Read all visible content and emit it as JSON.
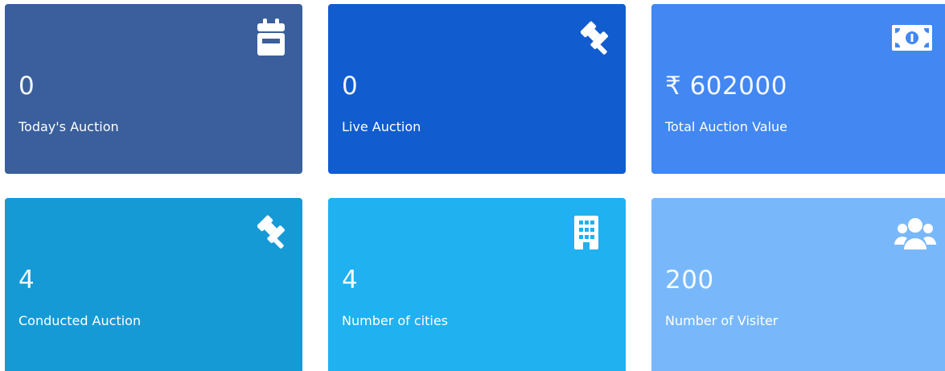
{
  "cards": [
    {
      "value": "0",
      "label": "Today's Auction",
      "icon": "calendar-icon",
      "color": "#3a5f9c"
    },
    {
      "value": "0",
      "label": "Live Auction",
      "icon": "gavel-icon",
      "color": "#115ccf"
    },
    {
      "value": "₹ 602000",
      "label": "Total Auction Value",
      "icon": "money-icon",
      "color": "#4287f2"
    },
    {
      "value": "4",
      "label": "Conducted Auction",
      "icon": "gavel-icon",
      "color": "#169ad5"
    },
    {
      "value": "4",
      "label": "Number of cities",
      "icon": "building-icon",
      "color": "#1fb1f0"
    },
    {
      "value": "200",
      "label": "Number of Visiter",
      "icon": "users-icon",
      "color": "#78b8fa"
    }
  ]
}
